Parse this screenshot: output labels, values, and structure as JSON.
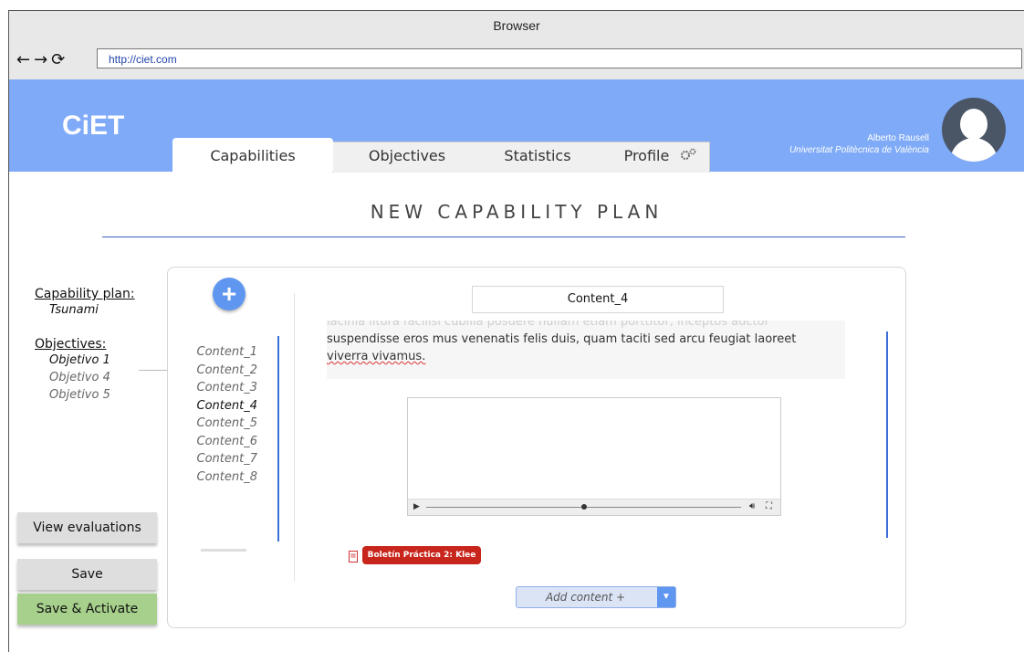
{
  "browser": {
    "title": "Browser",
    "url": "http://ciet.com",
    "nav": {
      "back": "←",
      "forward": "→",
      "reload": "⟳"
    }
  },
  "app": {
    "logo": "CiET",
    "tabs": [
      {
        "label": "Capabilities",
        "active": true
      },
      {
        "label": "Objectives"
      },
      {
        "label": "Statistics"
      },
      {
        "label": "Profile"
      }
    ],
    "profile_icon": "gear-icon",
    "user": {
      "name": "Alberto Rausell",
      "org": "Universitat Politècnica de València"
    }
  },
  "page": {
    "title": "NEW CAPABILITY PLAN",
    "capability_plan_label": "Capability plan:",
    "capability_plan_value": "Tsunami",
    "objectives_label": "Objectives:",
    "objectives": [
      "Objetivo 1",
      "Objetivo 4",
      "Objetivo 5"
    ]
  },
  "buttons": {
    "view_evaluations": "View evaluations",
    "save": "Save",
    "save_activate": "Save & Activate"
  },
  "editor": {
    "add_icon": "+",
    "contents": [
      "Content_1",
      "Content_2",
      "Content_3",
      "Content_4",
      "Content_5",
      "Content_6",
      "Content_7",
      "Content_8"
    ],
    "active_content": "Content_4",
    "content_name": "Content_4",
    "text_faded": "lacinia litora facilisi cubilia posuere nullam etiam porttitor, inceptos auctor",
    "text_line1": "suspendisse eros mus venenatis felis duis, quam taciti sed arcu feugiat laoreet",
    "text_line2": "viverra vivamus.",
    "attachment": "Boletín Práctica 2: Klee",
    "add_content": "Add content +",
    "dropdown_arrow": "▼"
  },
  "colors": {
    "header": "#7faaf7",
    "accent_blue": "#5e96f0",
    "save_activate": "#a6d08c",
    "attachment": "#c8261c"
  }
}
